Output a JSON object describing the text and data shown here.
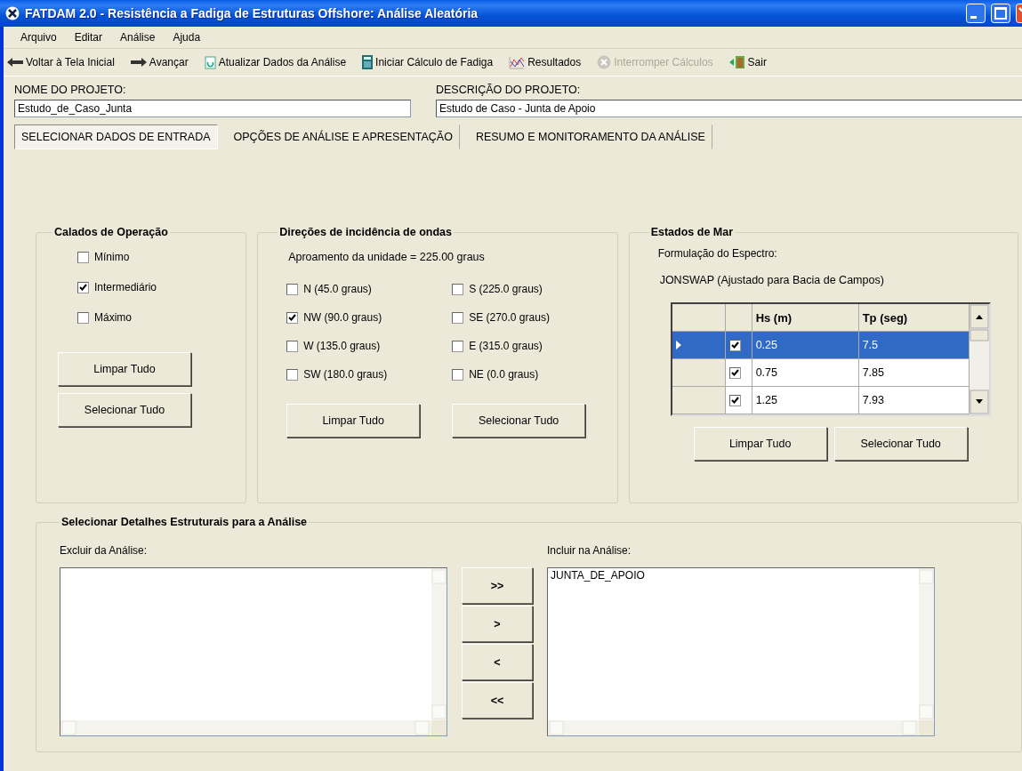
{
  "window": {
    "title": "FATDAM 2.0 - Resistência a Fadiga de Estruturas Offshore: Análise Aleatória"
  },
  "menu": [
    "Arquivo",
    "Editar",
    "Análise",
    "Ajuda"
  ],
  "toolbar": [
    {
      "kind": "back",
      "label": "Voltar à Tela Inicial",
      "disabled": false
    },
    {
      "kind": "forward",
      "label": "Avançar",
      "disabled": false
    },
    {
      "kind": "refresh",
      "label": "Atualizar Dados da Análise",
      "disabled": false
    },
    {
      "kind": "calculator",
      "label": "Iniciar Cálculo de Fadiga",
      "disabled": false
    },
    {
      "kind": "chart",
      "label": "Resultados",
      "disabled": false
    },
    {
      "kind": "stop",
      "label": "Interromper Cálculos",
      "disabled": true
    },
    {
      "kind": "exit",
      "label": "Sair",
      "disabled": false
    }
  ],
  "project": {
    "name_label": "NOME DO PROJETO:",
    "name": "Estudo_de_Caso_Junta",
    "description_label": "DESCRIÇÃO DO PROJETO:",
    "description": "Estudo de Caso - Junta de Apoio"
  },
  "tabs": [
    {
      "label": "SELECIONAR DADOS DE ENTRADA",
      "selected": true
    },
    {
      "label": "OPÇÕES DE ANÁLISE E APRESENTAÇÃO",
      "selected": false
    },
    {
      "label": "RESUMO E MONITORAMENTO DA ANÁLISE",
      "selected": false
    }
  ],
  "drafts": {
    "title": "Calados de Operação",
    "options": [
      {
        "label": "Mínimo",
        "checked": false
      },
      {
        "label": "Intermediário",
        "checked": true
      },
      {
        "label": "Máximo",
        "checked": false
      }
    ],
    "buttons": [
      "Limpar Tudo",
      "Selecionar Tudo"
    ]
  },
  "directions": {
    "title": "Direções de incidência de ondas",
    "heading": "Aproamento da unidade = 225.00 graus",
    "options": [
      {
        "label": "N (45.0 graus)",
        "checked": false
      },
      {
        "label": "S (225.0 graus)",
        "checked": false
      },
      {
        "label": "NW (90.0 graus)",
        "checked": true
      },
      {
        "label": "SE (270.0 graus)",
        "checked": false
      },
      {
        "label": "W (135.0 graus)",
        "checked": false
      },
      {
        "label": "E (315.0 graus)",
        "checked": false
      },
      {
        "label": "SW (180.0 graus)",
        "checked": false
      },
      {
        "label": "NE (0.0 graus)",
        "checked": false
      }
    ],
    "buttons": [
      "Limpar Tudo",
      "Selecionar Tudo"
    ]
  },
  "sea_states": {
    "title": "Estados de Mar",
    "formulation_label": "Formulação do Espectro:",
    "formulation": "JONSWAP (Ajustado para Bacia de Campos)",
    "columns": [
      "Hs (m)",
      "Tp (seg)"
    ],
    "rows": [
      {
        "selected": true,
        "checked": true,
        "hs": "0.25",
        "tp": "7.5"
      },
      {
        "selected": false,
        "checked": true,
        "hs": "0.75",
        "tp": "7.85"
      },
      {
        "selected": false,
        "checked": true,
        "hs": "1.25",
        "tp": "7.93"
      }
    ],
    "buttons": [
      "Limpar Tudo",
      "Selecionar Tudo"
    ]
  },
  "details": {
    "title": "Selecionar Detalhes Estruturais para a Análise",
    "exclude_label": "Excluir da Análise:",
    "include_label": "Incluir na Análise:",
    "include_items": [
      "JUNTA_DE_APOIO"
    ],
    "move_buttons": [
      ">>",
      ">",
      "<",
      "<<"
    ]
  }
}
